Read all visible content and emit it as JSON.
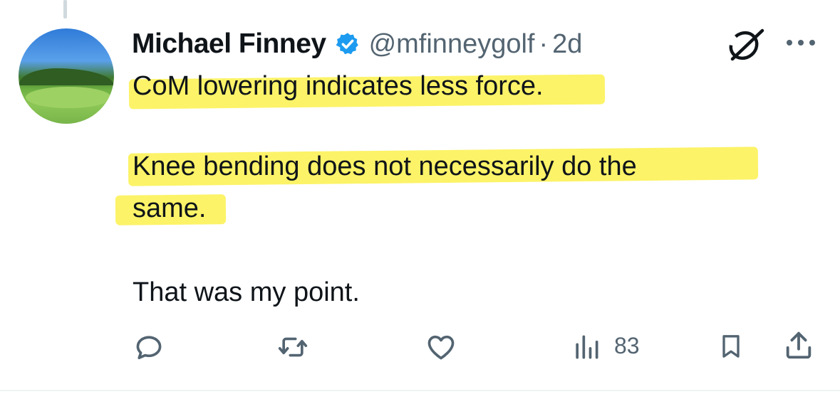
{
  "tweet": {
    "author": {
      "display_name": "Michael Finney",
      "handle": "@mfinneygolf",
      "verified": true,
      "avatar": "golf-course-avatar"
    },
    "separator": "·",
    "time": "2d",
    "lines": [
      "CoM lowering indicates less force.",
      "Knee bending does not necessarily do the",
      "same.",
      "That was my point."
    ],
    "highlighted_lines": [
      0,
      1,
      2
    ],
    "actions": {
      "reply_icon": "reply-icon",
      "retweet_icon": "retweet-icon",
      "like_icon": "heart-icon",
      "views_icon": "views-icon",
      "views_count": "83",
      "bookmark_icon": "bookmark-icon",
      "share_icon": "share-icon"
    }
  },
  "colors": {
    "text": "#0f1419",
    "secondary": "#536471",
    "verified": "#1d9bf0",
    "highlight": "#fcf25b"
  }
}
